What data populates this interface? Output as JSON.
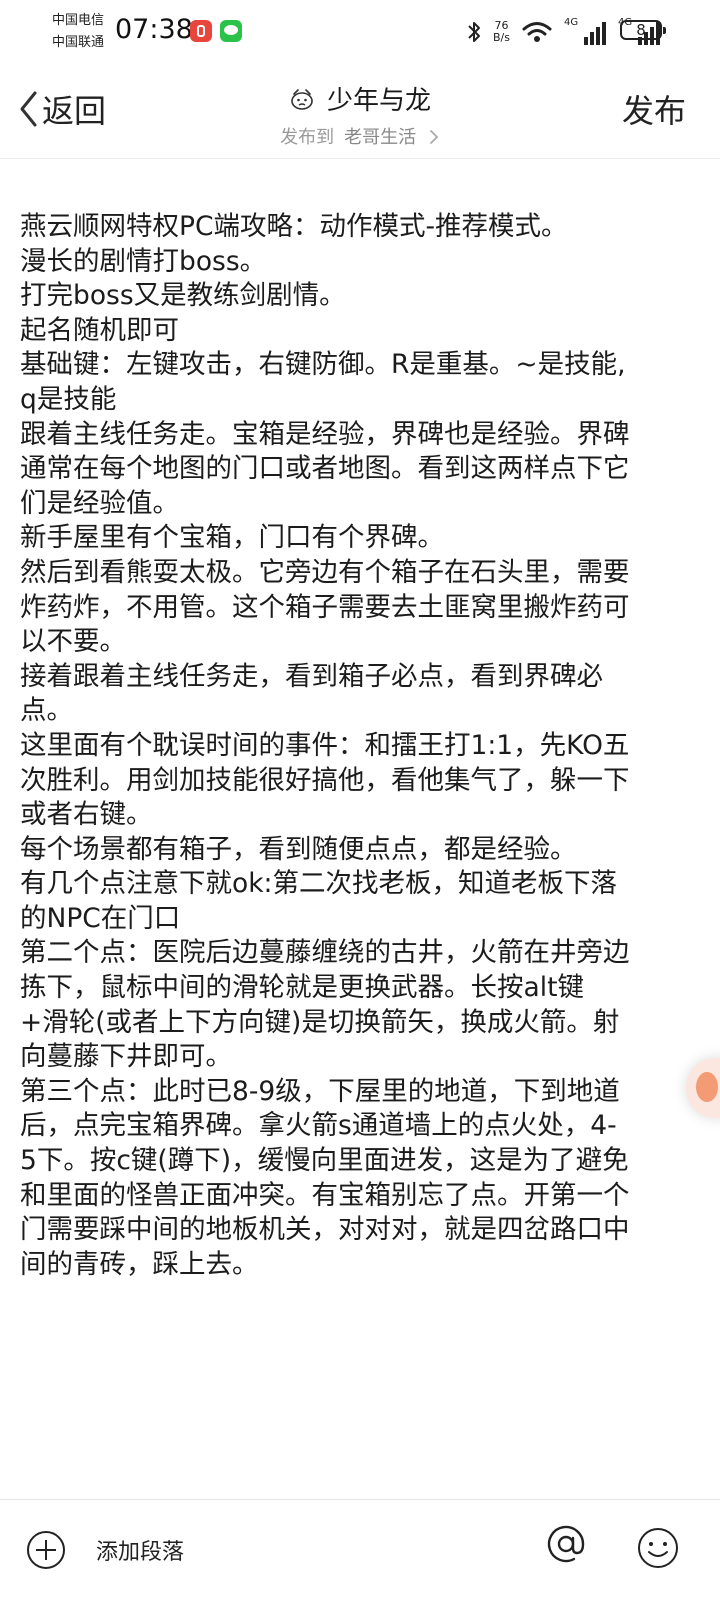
{
  "status_bar": {
    "carrier_1": "中国电信",
    "carrier_2": "中国联通",
    "time": "07:38",
    "net_speed_value": "76",
    "net_speed_unit": "B/s",
    "signal_1_tag": "4G",
    "signal_2_tag": "4G",
    "battery": "8"
  },
  "header": {
    "back_label": "返回",
    "title": "少年与龙",
    "publish_to_label": "发布到",
    "publish_target": "老哥生活",
    "publish_button": "发布"
  },
  "content": {
    "paragraphs": [
      "燕云顺网特权PC端攻略：动作模式-推荐模式。",
      "漫长的剧情打boss。",
      "打完boss又是教练剑剧情。",
      "起名随机即可",
      "基础键：左键攻击，右键防御。R是重基。~是技能,q是技能",
      "跟着主线任务走。宝箱是经验，界碑也是经验。界碑通常在每个地图的门口或者地图。看到这两样点下它们是经验值。",
      "新手屋里有个宝箱，门口有个界碑。",
      "然后到看熊耍太极。它旁边有个箱子在石头里，需要炸药炸，不用管。这个箱子需要去土匪窝里搬炸药可以不要。",
      "接着跟着主线任务走，看到箱子必点，看到界碑必点。",
      "这里面有个耽误时间的事件：和擂王打1:1，先KO五次胜利。用剑加技能很好搞他，看他集气了，躲一下或者右键。",
      "每个场景都有箱子，看到随便点点，都是经验。",
      "有几个点注意下就ok:第二次找老板，知道老板下落的NPC在门口",
      "第二个点：医院后边蔓藤缠绕的古井，火箭在井旁边拣下，鼠标中间的滑轮就是更换武器。长按alt键+滑轮(或者上下方向键)是切换箭矢，换成火箭。射向蔓藤下井即可。",
      "第三个点：此时已8-9级，下屋里的地道，下到地道后，点完宝箱界碑。拿火箭s通道墙上的点火处，4-5下。按c键(蹲下)，缓慢向里面进发，这是为了避免和里面的怪兽正面冲突。有宝箱别忘了点。开第一个门需要踩中间的地板机关，对对对，就是四岔路口中间的青砖，踩上去。"
    ]
  },
  "toolbar": {
    "add_paragraph_label": "添加段落"
  },
  "icons": {
    "back": "chevron-left-icon",
    "add": "plus-circle-icon",
    "mention": "at-icon",
    "emoji": "smiley-icon",
    "title_emoji": "face-emoji-icon"
  },
  "colors": {
    "text": "#1c1c1c",
    "secondary_text": "#9a9a9a",
    "divider": "#ececec"
  }
}
